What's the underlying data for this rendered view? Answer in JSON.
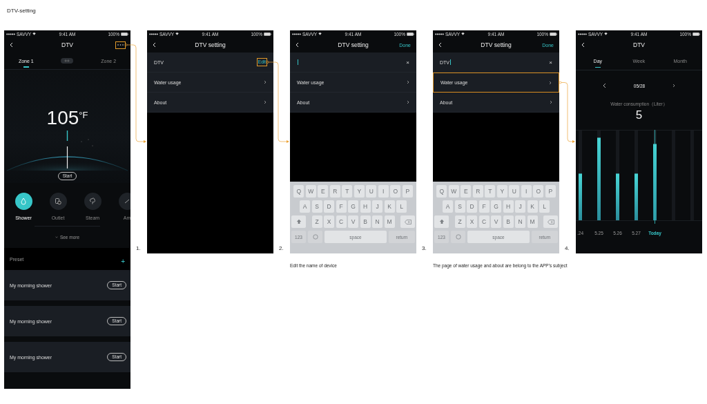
{
  "page_title": "DTV-setting",
  "screens": [
    {
      "kind": "control",
      "status_bar": {
        "carrier": "SAVVY",
        "time": "9:41 AM",
        "battery": "100%"
      },
      "title": "DTV",
      "menu_highlighted": true,
      "zones": [
        {
          "label": "Zone 1",
          "selected": true
        },
        {
          "label": "Zone 2",
          "selected": false
        }
      ],
      "temperature": "105",
      "unit": "°F",
      "start_label": "Start",
      "modes": [
        {
          "label": "Shower",
          "selected": true
        },
        {
          "label": "Outlet",
          "selected": false
        },
        {
          "label": "Steam",
          "selected": false
        },
        {
          "label": "Am",
          "selected": false
        }
      ],
      "see_more": "See more",
      "preset_title": "Preset",
      "add_label": "+",
      "presets": [
        {
          "name": "My morning shower",
          "action": "Start"
        },
        {
          "name": "My morning shower",
          "action": "Start"
        },
        {
          "name": "My morning shower",
          "action": "Start"
        }
      ]
    },
    {
      "kind": "settings",
      "step": "1.",
      "status_bar": {
        "carrier": "SAVVY",
        "time": "9:41 AM",
        "battery": "100%"
      },
      "title": "DTV setting",
      "rows": [
        {
          "kind": "name",
          "label": "DTV",
          "action": "Edit",
          "highlighted": true
        },
        {
          "kind": "link",
          "label": "Water usage",
          "highlighted": false
        },
        {
          "kind": "link",
          "label": "About",
          "highlighted": false
        }
      ]
    },
    {
      "kind": "settings",
      "step": "2.",
      "status_bar": {
        "carrier": "SAVVY",
        "time": "9:41 AM",
        "battery": "100%"
      },
      "title": "DTV setting",
      "done": "Done",
      "rows": [
        {
          "kind": "field",
          "clear": "×",
          "highlighted": false
        },
        {
          "kind": "link",
          "label": "Water usage",
          "highlighted": false
        },
        {
          "kind": "link",
          "label": "About",
          "highlighted": false
        }
      ],
      "keyboard": {
        "rows": [
          [
            "Q",
            "W",
            "E",
            "R",
            "T",
            "Y",
            "U",
            "I",
            "O",
            "P"
          ],
          [
            "A",
            "S",
            "D",
            "F",
            "G",
            "H",
            "J",
            "K",
            "L"
          ],
          [
            "Z",
            "X",
            "C",
            "V",
            "B",
            "N",
            "M"
          ]
        ],
        "numbers": "123",
        "space": "space",
        "return": "return"
      },
      "caption": "Edit the name of device"
    },
    {
      "kind": "settings",
      "step": "3.",
      "status_bar": {
        "carrier": "SAVVY",
        "time": "9:41 AM",
        "battery": "100%"
      },
      "title": "DTV setting",
      "done": "Done",
      "rows": [
        {
          "kind": "field",
          "value": "DTV",
          "clear": "×",
          "highlighted": false
        },
        {
          "kind": "link",
          "label": "Water usage",
          "highlighted": true
        },
        {
          "kind": "link",
          "label": "About",
          "highlighted": false
        }
      ],
      "keyboard": {
        "rows": [
          [
            "Q",
            "W",
            "E",
            "R",
            "T",
            "Y",
            "U",
            "I",
            "O",
            "P"
          ],
          [
            "A",
            "S",
            "D",
            "F",
            "G",
            "H",
            "J",
            "K",
            "L"
          ],
          [
            "Z",
            "X",
            "C",
            "V",
            "B",
            "N",
            "M"
          ]
        ],
        "numbers": "123",
        "space": "space",
        "return": "return"
      },
      "caption": "The page of water usage and about are belong to the APP's subject"
    },
    {
      "kind": "usage",
      "step": "4.",
      "status_bar": {
        "carrier": "SAVVY",
        "time": "9:41 AM",
        "battery": "100%"
      },
      "title": "DTV",
      "periods": [
        {
          "label": "Day",
          "selected": true
        },
        {
          "label": "Week",
          "selected": false
        },
        {
          "label": "Month",
          "selected": false
        }
      ],
      "date": "05/28",
      "metric": "Water consumption（Liter）",
      "amount": "5",
      "days": [
        {
          "label": ".24",
          "selected": false
        },
        {
          "label": "5.25",
          "selected": false
        },
        {
          "label": "5.26",
          "selected": false
        },
        {
          "label": "5.27",
          "selected": false
        },
        {
          "label": "Today",
          "selected": true
        }
      ]
    }
  ]
}
